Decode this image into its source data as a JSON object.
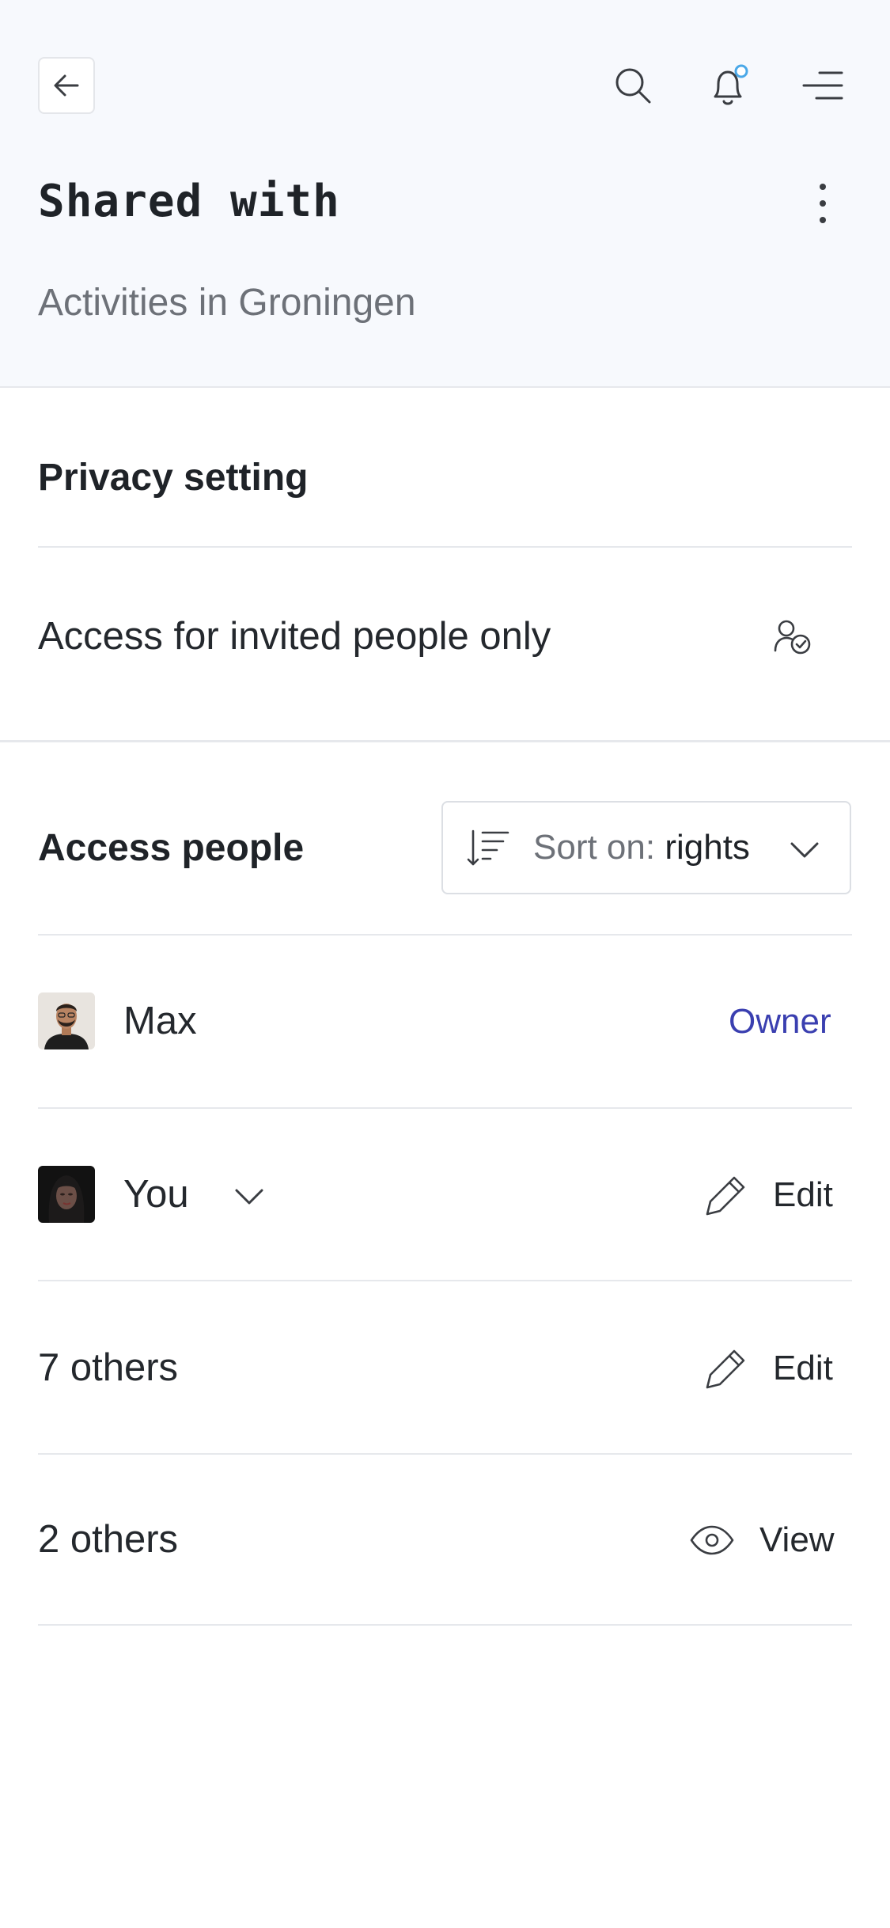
{
  "header": {
    "title": "Shared with",
    "subtitle": "Activities in Groningen",
    "icons": {
      "back": "arrow-left-icon",
      "search": "search-icon",
      "notifications": "bell-icon",
      "menu": "menu-icon",
      "more": "more-vertical-icon"
    },
    "notification_dot_color": "#4aa8e8"
  },
  "privacy": {
    "title": "Privacy setting",
    "value": "Access for invited people only",
    "icon": "user-check-icon"
  },
  "access": {
    "title": "Access people",
    "sort_prefix": "Sort on:",
    "sort_value": "rights",
    "people": [
      {
        "name": "Max",
        "role": "Owner",
        "role_color": "#3a3fb0"
      },
      {
        "name": "You",
        "role": "Edit",
        "role_icon": "pencil-icon"
      }
    ],
    "groups": [
      {
        "label": "7 others",
        "role": "Edit",
        "role_icon": "pencil-icon"
      },
      {
        "label": "2 others",
        "role": "View",
        "role_icon": "eye-icon"
      }
    ]
  }
}
